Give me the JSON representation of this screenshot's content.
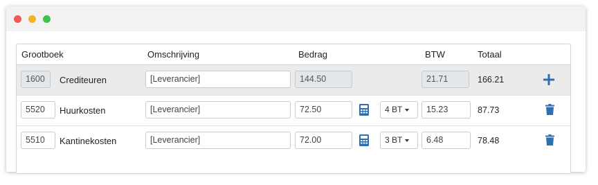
{
  "colors": {
    "accent": "#2f6fb0"
  },
  "window": {
    "controls": [
      "close",
      "minimize",
      "maximize"
    ]
  },
  "table": {
    "headers": {
      "grootboek": "Grootboek",
      "omschrijving": "Omschrijving",
      "bedrag": "Bedrag",
      "btw": "BTW",
      "totaal": "Totaal"
    },
    "rows": [
      {
        "code": "1600",
        "name": "Crediteuren",
        "description": "[Leverancier]",
        "amount": "144.50",
        "vat": "21.71",
        "total": "166.21",
        "action_icon": "plus-icon"
      },
      {
        "code": "5520",
        "name": "Huurkosten",
        "description": "[Leverancier]",
        "amount": "72.50",
        "vat_code": "4 BT",
        "vat": "15.23",
        "total": "87.73",
        "calc_icon": "calculator-icon",
        "action_icon": "trash-icon"
      },
      {
        "code": "5510",
        "name": "Kantinekosten",
        "description": "[Leverancier]",
        "amount": "72.00",
        "vat_code": "3 BT",
        "vat": "6.48",
        "total": "78.48",
        "calc_icon": "calculator-icon",
        "action_icon": "trash-icon"
      }
    ]
  }
}
